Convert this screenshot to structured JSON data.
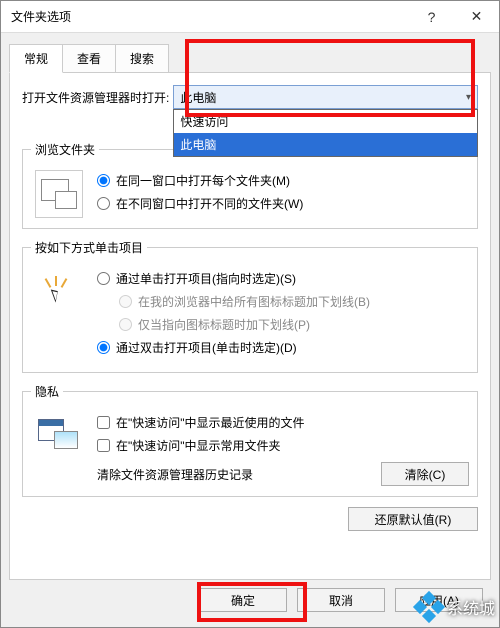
{
  "window": {
    "title": "文件夹选项"
  },
  "tabs": {
    "general": "常规",
    "view": "查看",
    "search": "搜索"
  },
  "open_in_label": "打开文件资源管理器时打开:",
  "combo": {
    "selected": "此电脑",
    "options": {
      "quick": "快速访问",
      "thispc": "此电脑"
    }
  },
  "browse": {
    "legend": "浏览文件夹",
    "same": "在同一窗口中打开每个文件夹(M)",
    "diff": "在不同窗口中打开不同的文件夹(W)"
  },
  "click": {
    "legend": "按如下方式单击项目",
    "single": "通过单击打开项目(指向时选定)(S)",
    "sub_all": "在我的浏览器中给所有图标标题加下划线(B)",
    "sub_point": "仅当指向图标标题时加下划线(P)",
    "double": "通过双击打开项目(单击时选定)(D)"
  },
  "privacy": {
    "legend": "隐私",
    "recent": "在\"快速访问\"中显示最近使用的文件",
    "freq": "在\"快速访问\"中显示常用文件夹",
    "clear_label": "清除文件资源管理器历史记录",
    "clear_btn": "清除(C)"
  },
  "restore": "还原默认值(R)",
  "buttons": {
    "ok": "确定",
    "cancel": "取消",
    "apply": "应用(A)"
  },
  "watermark": "系统城"
}
